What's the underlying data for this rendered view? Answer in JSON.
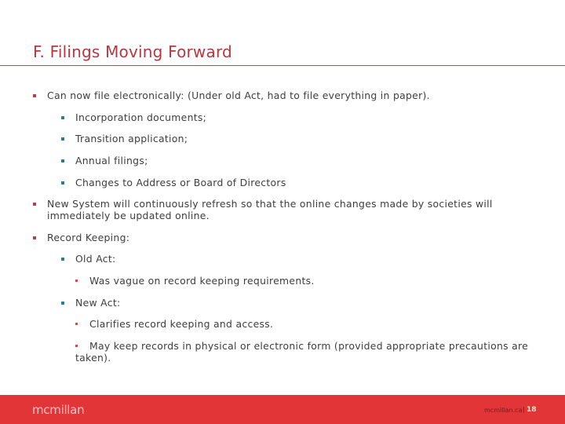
{
  "slide": {
    "title": "F. Filings Moving Forward",
    "bullets": [
      {
        "level": 1,
        "text": "Can now file electronically: (Under old Act, had to file everything in paper)."
      },
      {
        "level": 2,
        "text": "Incorporation documents;"
      },
      {
        "level": 2,
        "text": "Transition application;"
      },
      {
        "level": 2,
        "text": "Annual filings;"
      },
      {
        "level": 2,
        "text": "Changes to Address or Board of Directors"
      },
      {
        "level": 1,
        "text": "New System will continuously refresh so that the online changes made by societies will",
        "continuation": "immediately be updated online."
      },
      {
        "level": 1,
        "text": "Record Keeping:"
      },
      {
        "level": 2,
        "text": "Old Act:"
      },
      {
        "level": 3,
        "text": "Was vague on record keeping requirements."
      },
      {
        "level": 2,
        "text": "New Act:"
      },
      {
        "level": 3,
        "text": "Clarifies record keeping and access."
      },
      {
        "level": 3,
        "text": "May keep records in physical or electronic form (provided appropriate precautions are",
        "continuation": "taken)."
      }
    ]
  },
  "footer": {
    "logo": "mcmillan",
    "site": "mcmillan.ca",
    "separator": "|",
    "page_number": "18"
  },
  "colors": {
    "title": "#b8373f",
    "footer_bg": "#e23538",
    "level1_bullet": "#b5414a",
    "level2_bullet": "#2b7f8c",
    "level3_bullet": "#d04a52"
  }
}
